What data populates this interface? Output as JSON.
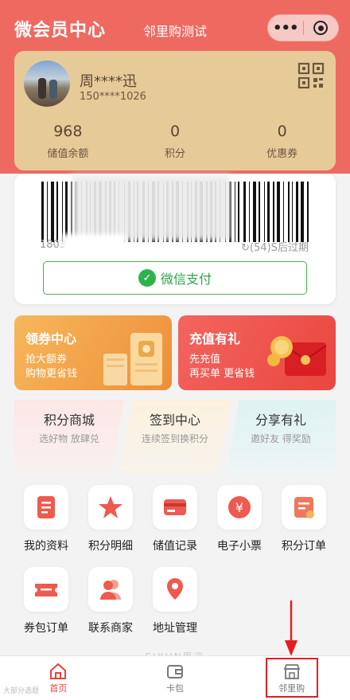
{
  "header": {
    "brand": "微会员中心",
    "title": "邻里购测试"
  },
  "capsule": {
    "more_icon": "more-dots-icon",
    "close_icon": "close-miniprogram-icon"
  },
  "member": {
    "name": "周****迅",
    "phone": "150****1026",
    "stats": [
      {
        "value": "968",
        "label": "储值余额"
      },
      {
        "value": "0",
        "label": "积分"
      },
      {
        "value": "0",
        "label": "优惠券"
      }
    ]
  },
  "payment": {
    "code_prefix": "1803",
    "expire_text": "(54)S后过期",
    "wechat_pay_label": "微信支付"
  },
  "promos": [
    {
      "title": "领券中心",
      "line1": "抢大额券",
      "line2": "购物更省钱",
      "color": "#ee8f3a"
    },
    {
      "title": "充值有礼",
      "line1": "先充值",
      "line2": "再买单 更省钱",
      "color": "#e9463e"
    }
  ],
  "features": [
    {
      "title": "积分商城",
      "subtitle": "选好物 放肆兑"
    },
    {
      "title": "签到中心",
      "subtitle": "连续签到换积分"
    },
    {
      "title": "分享有礼",
      "subtitle": "邀好友 得奖励"
    }
  ],
  "grid": [
    {
      "label": "我的资料",
      "icon": "profile-doc-icon"
    },
    {
      "label": "积分明细",
      "icon": "star-icon"
    },
    {
      "label": "储值记录",
      "icon": "card-icon"
    },
    {
      "label": "电子小票",
      "icon": "receipt-yuan-icon"
    },
    {
      "label": "积分订单",
      "icon": "order-icon"
    },
    {
      "label": "券包订单",
      "icon": "ticket-icon"
    },
    {
      "label": "联系商家",
      "icon": "contact-icon"
    },
    {
      "label": "地址管理",
      "icon": "location-icon"
    }
  ],
  "footer_brand": "SIXUN思迅",
  "tabs": [
    {
      "label": "首页",
      "icon": "home-icon",
      "active": true
    },
    {
      "label": "卡包",
      "icon": "wallet-icon",
      "active": false
    },
    {
      "label": "邻里购",
      "icon": "shop-icon",
      "active": false
    }
  ],
  "watermark": "大部分选题",
  "accent": "#e8443c"
}
